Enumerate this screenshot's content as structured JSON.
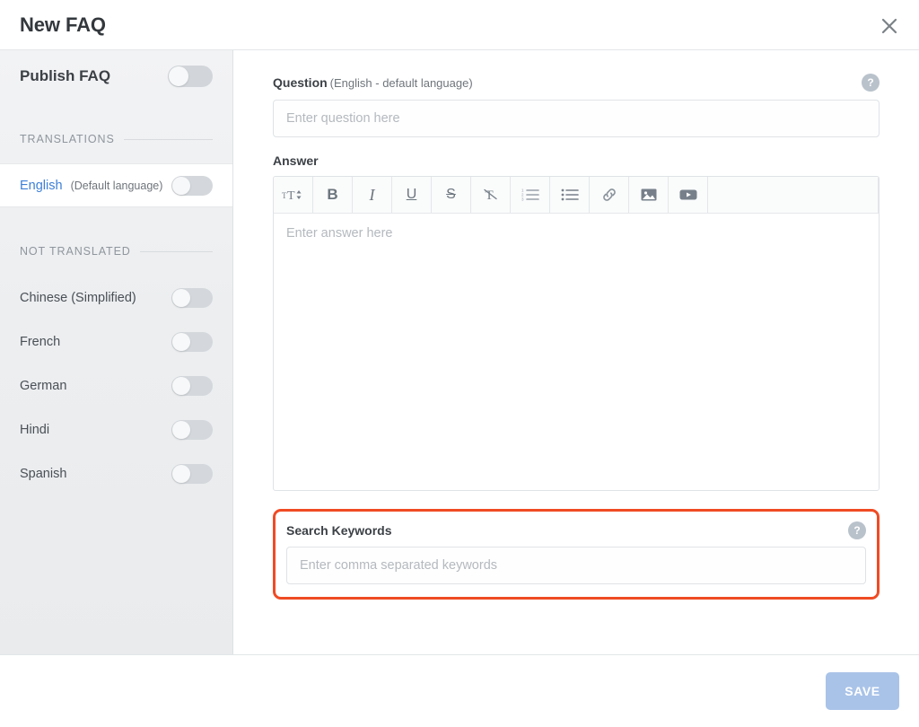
{
  "dialog": {
    "title": "New FAQ",
    "close_icon": "close-icon"
  },
  "sidebar": {
    "publish": {
      "label": "Publish FAQ",
      "toggle_on": false
    },
    "translations_section": {
      "heading": "TRANSLATIONS",
      "items": [
        {
          "name": "English",
          "note": "(Default language)",
          "active": true,
          "toggle_on": false
        }
      ]
    },
    "not_translated_section": {
      "heading": "NOT TRANSLATED",
      "items": [
        {
          "name": "Chinese (Simplified)",
          "toggle_on": false
        },
        {
          "name": "French",
          "toggle_on": false
        },
        {
          "name": "German",
          "toggle_on": false
        },
        {
          "name": "Hindi",
          "toggle_on": false
        },
        {
          "name": "Spanish",
          "toggle_on": false
        }
      ]
    }
  },
  "content": {
    "question": {
      "label": "Question",
      "sublabel": "(English - default language)",
      "placeholder": "Enter question here",
      "value": "",
      "help_icon": "help-icon"
    },
    "answer": {
      "label": "Answer",
      "placeholder": "Enter answer here",
      "value": "",
      "toolbar": [
        {
          "name": "font-size-icon",
          "label": "ᴛT↕"
        },
        {
          "name": "bold-icon",
          "label": "B"
        },
        {
          "name": "italic-icon",
          "label": "I"
        },
        {
          "name": "underline-icon",
          "label": "U"
        },
        {
          "name": "strikethrough-icon",
          "label": "S"
        },
        {
          "name": "clear-formatting-icon",
          "label": "T̶"
        },
        {
          "name": "ordered-list-icon",
          "label": ""
        },
        {
          "name": "unordered-list-icon",
          "label": ""
        },
        {
          "name": "link-icon",
          "label": ""
        },
        {
          "name": "image-icon",
          "label": ""
        },
        {
          "name": "video-icon",
          "label": ""
        }
      ]
    },
    "keywords": {
      "label": "Search Keywords",
      "placeholder": "Enter comma separated keywords",
      "value": "",
      "help_icon": "help-icon",
      "highlighted": true,
      "highlight_color": "#f04b24"
    }
  },
  "footer": {
    "save_label": "SAVE",
    "save_color": "#a9c3e8"
  }
}
